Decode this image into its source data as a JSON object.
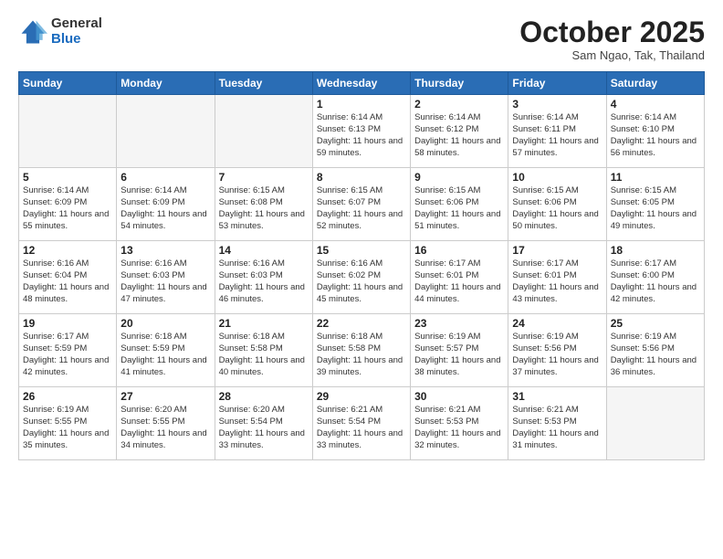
{
  "header": {
    "logo_general": "General",
    "logo_blue": "Blue",
    "month_title": "October 2025",
    "location": "Sam Ngao, Tak, Thailand"
  },
  "weekdays": [
    "Sunday",
    "Monday",
    "Tuesday",
    "Wednesday",
    "Thursday",
    "Friday",
    "Saturday"
  ],
  "weeks": [
    [
      {
        "day": "",
        "empty": true
      },
      {
        "day": "",
        "empty": true
      },
      {
        "day": "",
        "empty": true
      },
      {
        "day": "1",
        "sunrise": "Sunrise: 6:14 AM",
        "sunset": "Sunset: 6:13 PM",
        "daylight": "Daylight: 11 hours and 59 minutes."
      },
      {
        "day": "2",
        "sunrise": "Sunrise: 6:14 AM",
        "sunset": "Sunset: 6:12 PM",
        "daylight": "Daylight: 11 hours and 58 minutes."
      },
      {
        "day": "3",
        "sunrise": "Sunrise: 6:14 AM",
        "sunset": "Sunset: 6:11 PM",
        "daylight": "Daylight: 11 hours and 57 minutes."
      },
      {
        "day": "4",
        "sunrise": "Sunrise: 6:14 AM",
        "sunset": "Sunset: 6:10 PM",
        "daylight": "Daylight: 11 hours and 56 minutes."
      }
    ],
    [
      {
        "day": "5",
        "sunrise": "Sunrise: 6:14 AM",
        "sunset": "Sunset: 6:09 PM",
        "daylight": "Daylight: 11 hours and 55 minutes."
      },
      {
        "day": "6",
        "sunrise": "Sunrise: 6:14 AM",
        "sunset": "Sunset: 6:09 PM",
        "daylight": "Daylight: 11 hours and 54 minutes."
      },
      {
        "day": "7",
        "sunrise": "Sunrise: 6:15 AM",
        "sunset": "Sunset: 6:08 PM",
        "daylight": "Daylight: 11 hours and 53 minutes."
      },
      {
        "day": "8",
        "sunrise": "Sunrise: 6:15 AM",
        "sunset": "Sunset: 6:07 PM",
        "daylight": "Daylight: 11 hours and 52 minutes."
      },
      {
        "day": "9",
        "sunrise": "Sunrise: 6:15 AM",
        "sunset": "Sunset: 6:06 PM",
        "daylight": "Daylight: 11 hours and 51 minutes."
      },
      {
        "day": "10",
        "sunrise": "Sunrise: 6:15 AM",
        "sunset": "Sunset: 6:06 PM",
        "daylight": "Daylight: 11 hours and 50 minutes."
      },
      {
        "day": "11",
        "sunrise": "Sunrise: 6:15 AM",
        "sunset": "Sunset: 6:05 PM",
        "daylight": "Daylight: 11 hours and 49 minutes."
      }
    ],
    [
      {
        "day": "12",
        "sunrise": "Sunrise: 6:16 AM",
        "sunset": "Sunset: 6:04 PM",
        "daylight": "Daylight: 11 hours and 48 minutes."
      },
      {
        "day": "13",
        "sunrise": "Sunrise: 6:16 AM",
        "sunset": "Sunset: 6:03 PM",
        "daylight": "Daylight: 11 hours and 47 minutes."
      },
      {
        "day": "14",
        "sunrise": "Sunrise: 6:16 AM",
        "sunset": "Sunset: 6:03 PM",
        "daylight": "Daylight: 11 hours and 46 minutes."
      },
      {
        "day": "15",
        "sunrise": "Sunrise: 6:16 AM",
        "sunset": "Sunset: 6:02 PM",
        "daylight": "Daylight: 11 hours and 45 minutes."
      },
      {
        "day": "16",
        "sunrise": "Sunrise: 6:17 AM",
        "sunset": "Sunset: 6:01 PM",
        "daylight": "Daylight: 11 hours and 44 minutes."
      },
      {
        "day": "17",
        "sunrise": "Sunrise: 6:17 AM",
        "sunset": "Sunset: 6:01 PM",
        "daylight": "Daylight: 11 hours and 43 minutes."
      },
      {
        "day": "18",
        "sunrise": "Sunrise: 6:17 AM",
        "sunset": "Sunset: 6:00 PM",
        "daylight": "Daylight: 11 hours and 42 minutes."
      }
    ],
    [
      {
        "day": "19",
        "sunrise": "Sunrise: 6:17 AM",
        "sunset": "Sunset: 5:59 PM",
        "daylight": "Daylight: 11 hours and 42 minutes."
      },
      {
        "day": "20",
        "sunrise": "Sunrise: 6:18 AM",
        "sunset": "Sunset: 5:59 PM",
        "daylight": "Daylight: 11 hours and 41 minutes."
      },
      {
        "day": "21",
        "sunrise": "Sunrise: 6:18 AM",
        "sunset": "Sunset: 5:58 PM",
        "daylight": "Daylight: 11 hours and 40 minutes."
      },
      {
        "day": "22",
        "sunrise": "Sunrise: 6:18 AM",
        "sunset": "Sunset: 5:58 PM",
        "daylight": "Daylight: 11 hours and 39 minutes."
      },
      {
        "day": "23",
        "sunrise": "Sunrise: 6:19 AM",
        "sunset": "Sunset: 5:57 PM",
        "daylight": "Daylight: 11 hours and 38 minutes."
      },
      {
        "day": "24",
        "sunrise": "Sunrise: 6:19 AM",
        "sunset": "Sunset: 5:56 PM",
        "daylight": "Daylight: 11 hours and 37 minutes."
      },
      {
        "day": "25",
        "sunrise": "Sunrise: 6:19 AM",
        "sunset": "Sunset: 5:56 PM",
        "daylight": "Daylight: 11 hours and 36 minutes."
      }
    ],
    [
      {
        "day": "26",
        "sunrise": "Sunrise: 6:19 AM",
        "sunset": "Sunset: 5:55 PM",
        "daylight": "Daylight: 11 hours and 35 minutes."
      },
      {
        "day": "27",
        "sunrise": "Sunrise: 6:20 AM",
        "sunset": "Sunset: 5:55 PM",
        "daylight": "Daylight: 11 hours and 34 minutes."
      },
      {
        "day": "28",
        "sunrise": "Sunrise: 6:20 AM",
        "sunset": "Sunset: 5:54 PM",
        "daylight": "Daylight: 11 hours and 33 minutes."
      },
      {
        "day": "29",
        "sunrise": "Sunrise: 6:21 AM",
        "sunset": "Sunset: 5:54 PM",
        "daylight": "Daylight: 11 hours and 33 minutes."
      },
      {
        "day": "30",
        "sunrise": "Sunrise: 6:21 AM",
        "sunset": "Sunset: 5:53 PM",
        "daylight": "Daylight: 11 hours and 32 minutes."
      },
      {
        "day": "31",
        "sunrise": "Sunrise: 6:21 AM",
        "sunset": "Sunset: 5:53 PM",
        "daylight": "Daylight: 11 hours and 31 minutes."
      },
      {
        "day": "",
        "empty": true
      }
    ]
  ]
}
